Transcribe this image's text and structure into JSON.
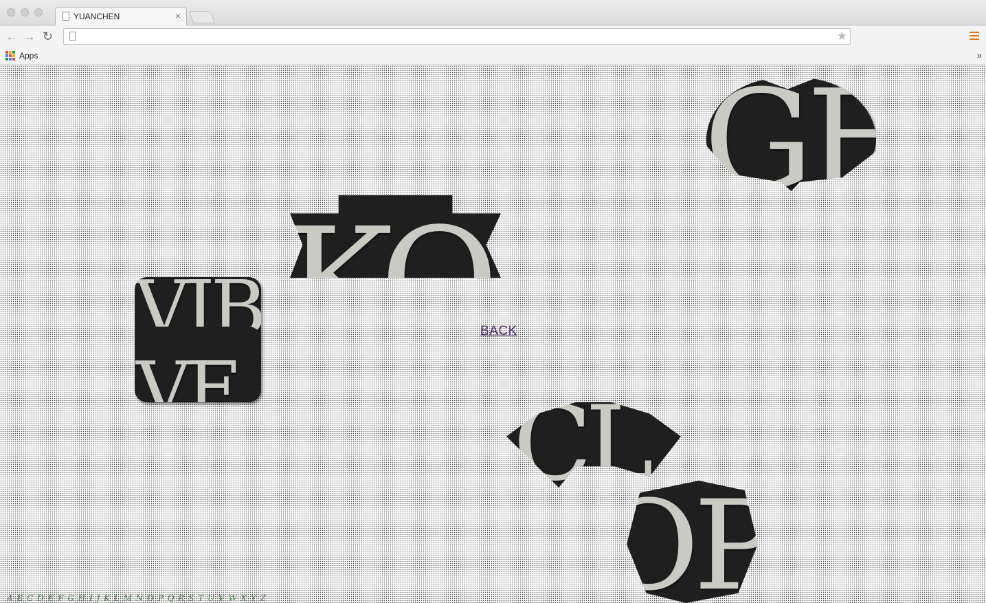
{
  "browser": {
    "tab_title": "YUANCHEN",
    "tab_close": "×",
    "url": "",
    "bookmarks": {
      "apps_label": "Apps",
      "overflow": "»"
    },
    "nav": {
      "back": "←",
      "forward": "→",
      "reload": "↻",
      "star": "★"
    }
  },
  "page": {
    "back_link": "BACK",
    "pieces": [
      {
        "name": "heart-piece",
        "letters": "GH"
      },
      {
        "name": "banner-piece",
        "letters": "KOL"
      },
      {
        "name": "cloud-piece",
        "letters_top": "VIB",
        "letters_bottom": "VF"
      },
      {
        "name": "arch-piece",
        "letters": "CL"
      },
      {
        "name": "hexagon-piece",
        "letters": "OP"
      }
    ],
    "alphabet": "A B C D E F G H I J K L M N O P Q R S T U V W X Y Z"
  },
  "colors": {
    "piece_bg": "#1f1f1f",
    "glyph": "#c9cbc3",
    "link": "#4b2a6b",
    "alphabet": "#4d7a4d",
    "menu": "#e07a16"
  }
}
